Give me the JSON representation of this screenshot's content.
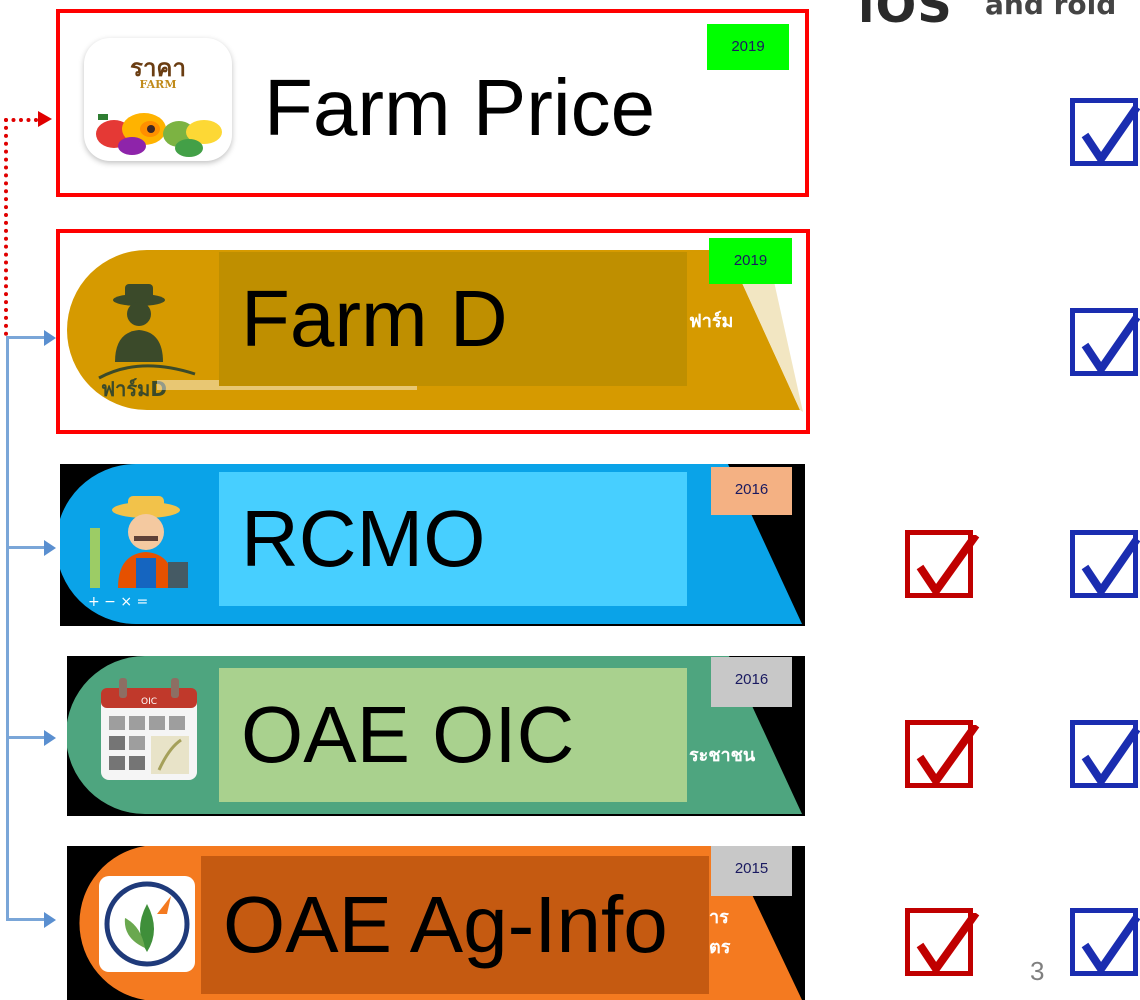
{
  "header": {
    "ios_label": "iOS",
    "android_label": "and roid"
  },
  "apps": [
    {
      "id": "farm-price",
      "title": "Farm Price",
      "year": "2019",
      "logo_text": "ราคา",
      "logo_sub": "FARM"
    },
    {
      "id": "farm-d",
      "title": "Farm D",
      "year": "2019",
      "side_text": "ฟาร์ม",
      "logo_text": "ฟาร์มD"
    },
    {
      "id": "rcmo",
      "title": "RCMO",
      "year": "2016"
    },
    {
      "id": "oae-oic",
      "title": "OAE OIC",
      "year": "2016",
      "side_text": "ระชาชน",
      "logo_text": "OIC"
    },
    {
      "id": "oae-ag-info",
      "title": "OAE Ag-Info",
      "year": "2015",
      "side_text_1": "าร",
      "side_text_2": "ตร"
    }
  ],
  "checks": {
    "ios": [
      false,
      false,
      true,
      true,
      true
    ],
    "android": [
      true,
      true,
      true,
      true,
      true
    ]
  },
  "colors": {
    "red_border": "#ff0000",
    "year_green": "#00ff00",
    "year_peach": "#f4b183",
    "year_grey": "#c8c8c8",
    "check_blue": "#1a2db0",
    "check_red": "#c00000"
  },
  "page_number": "3"
}
